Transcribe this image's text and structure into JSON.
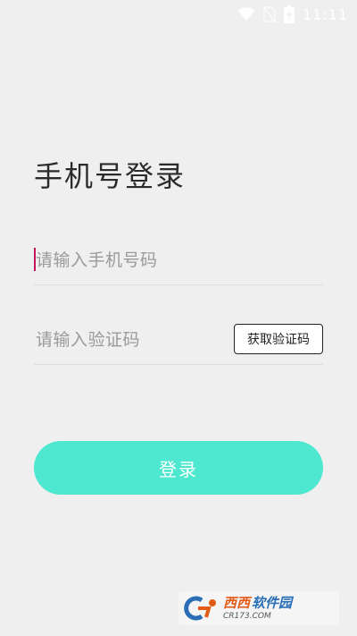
{
  "status_bar": {
    "time": "11:11",
    "icons": [
      "wifi-icon",
      "no-sim-icon",
      "battery-charging-icon"
    ]
  },
  "page": {
    "title": "手机号登录"
  },
  "phone_field": {
    "placeholder": "请输入手机号码",
    "value": ""
  },
  "code_field": {
    "placeholder": "请输入验证码",
    "value": "",
    "get_code_label": "获取验证码"
  },
  "login_button": {
    "label": "登录"
  },
  "watermark": {
    "name_a": "西西",
    "name_b": "软件园",
    "url": "CR173.COM"
  },
  "colors": {
    "background": "#efefef",
    "accent": "#4de8cf",
    "cursor": "#c2185b",
    "divider": "#dddddd"
  }
}
